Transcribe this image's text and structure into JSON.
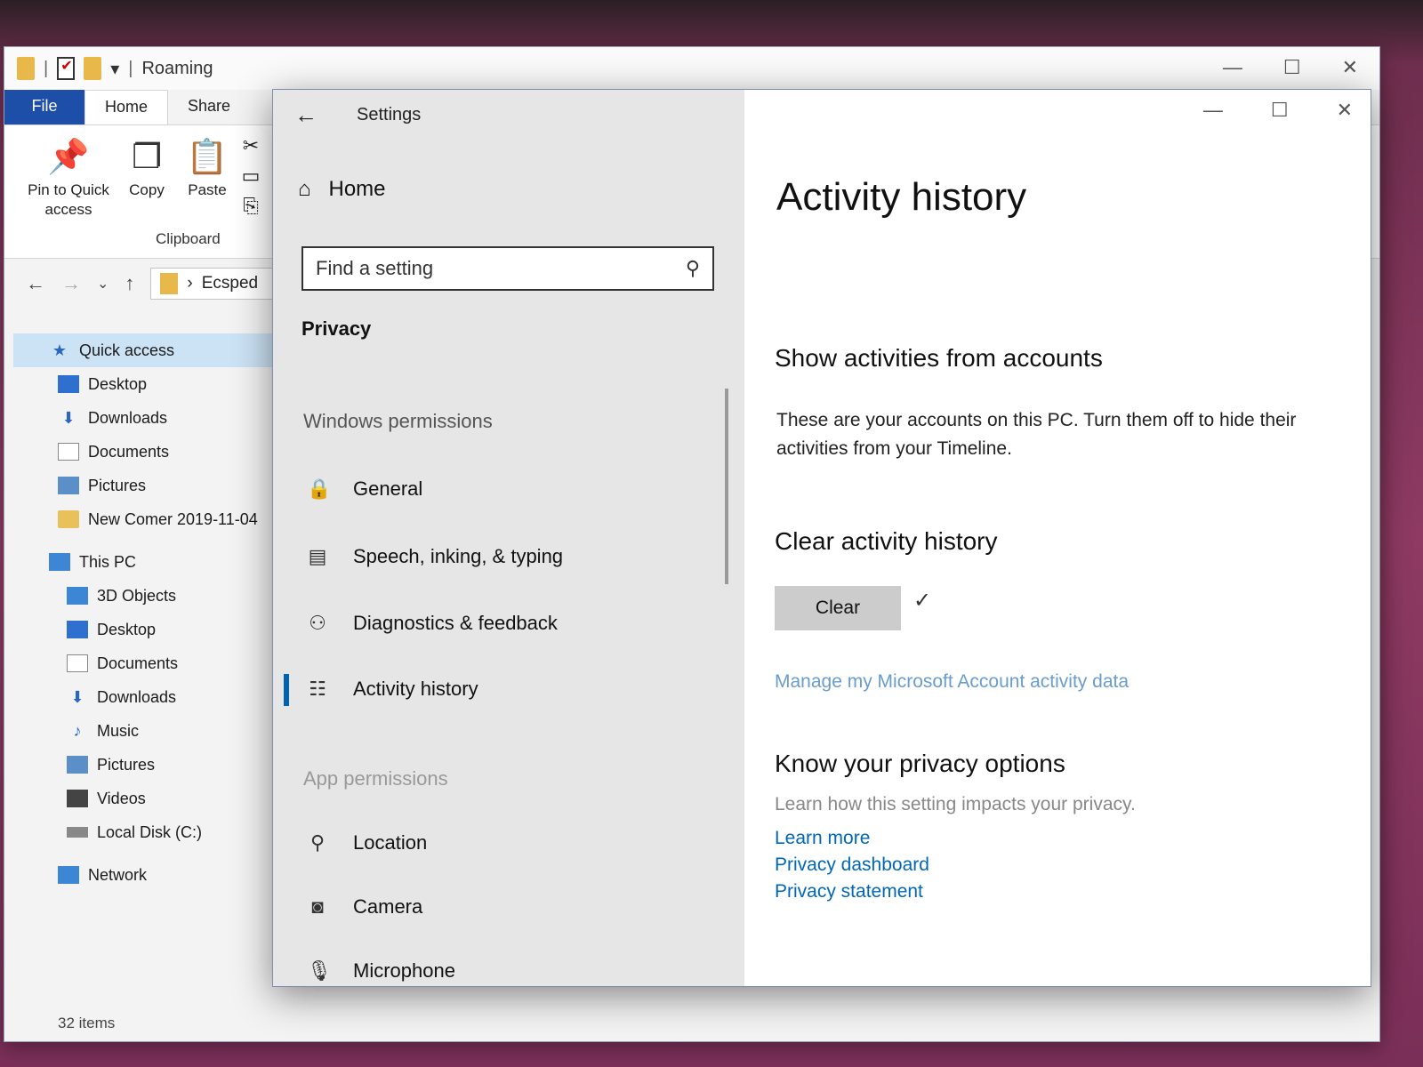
{
  "explorer": {
    "title": "Roaming",
    "tabs": [
      "File",
      "Home",
      "Share"
    ],
    "ribbon": {
      "pin_label": "Pin to Quick access",
      "copy_label": "Copy",
      "paste_label": "Paste",
      "group_label": "Clipboard"
    },
    "address": "Ecsped",
    "nav": {
      "quick_access": "Quick access",
      "quick_items": [
        "Desktop",
        "Downloads",
        "Documents",
        "Pictures",
        "New Comer 2019-11-04"
      ],
      "this_pc": "This PC",
      "pc_items": [
        "3D Objects",
        "Desktop",
        "Documents",
        "Downloads",
        "Music",
        "Pictures",
        "Videos",
        "Local Disk (C:)"
      ],
      "network": "Network"
    },
    "status": "32 items"
  },
  "settings": {
    "title": "Settings",
    "home_label": "Home",
    "search_placeholder": "Find a setting",
    "privacy_label": "Privacy",
    "windows_permissions": "Windows permissions",
    "menu_windows": [
      "General",
      "Speech, inking, & typing",
      "Diagnostics & feedback",
      "Activity history"
    ],
    "app_permissions": "App permissions",
    "menu_app": [
      "Location",
      "Camera",
      "Microphone"
    ],
    "page": {
      "title": "Activity history",
      "show_accounts_title": "Show activities from accounts",
      "show_accounts_text": "These are your accounts on this PC. Turn them off to hide their activities from your Timeline.",
      "clear_title": "Clear activity history",
      "clear_button": "Clear",
      "manage_link": "Manage my Microsoft Account activity data",
      "privacy_title": "Know your privacy options",
      "privacy_text": "Learn how this setting impacts your privacy.",
      "links": [
        "Learn more",
        "Privacy dashboard",
        "Privacy statement"
      ]
    }
  },
  "colors": {
    "accent": "#0063b1",
    "link": "#0067b8",
    "file_tab": "#1e4fa8"
  }
}
